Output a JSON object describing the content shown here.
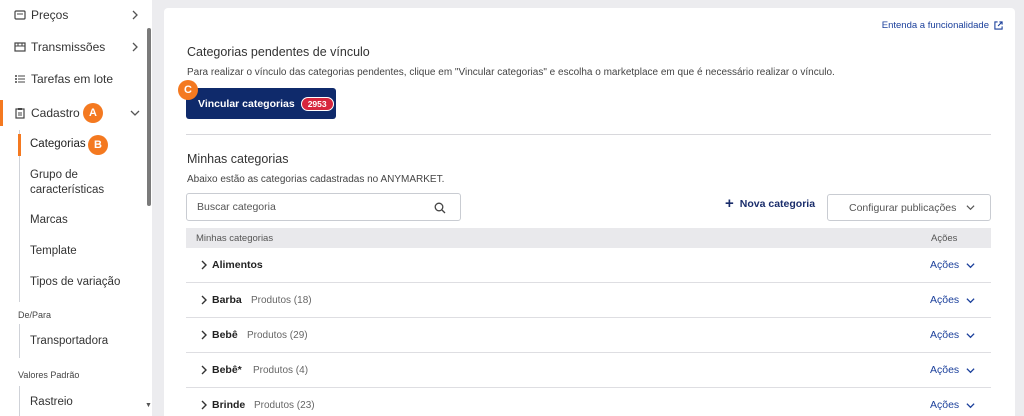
{
  "sidebar": {
    "items": [
      {
        "label": "Preços",
        "icon": "price-tag-icon"
      },
      {
        "label": "Transmissões",
        "icon": "broadcast-icon"
      },
      {
        "label": "Tarefas em lote",
        "icon": "list-icon"
      },
      {
        "label": "Cadastro",
        "icon": "clipboard-icon"
      }
    ],
    "cadastro_sub": [
      "Categorias",
      "Grupo de características",
      "Marcas",
      "Template",
      "Tipos de variação"
    ],
    "sections": [
      {
        "label": "De/Para",
        "items": [
          "Transportadora"
        ]
      },
      {
        "label": "Valores Padrão",
        "items": [
          "Rastreio"
        ]
      }
    ],
    "badge_a": "A",
    "badge_b": "B"
  },
  "main": {
    "help_link": "Entenda a funcionalidade",
    "pending_title": "Categorias pendentes de vínculo",
    "pending_desc": "Para realizar o vínculo das categorias pendentes, clique em \"Vincular categorias\" e escolha o marketplace em que é necessário realizar o vínculo.",
    "vincular_label": "Vincular categorias",
    "pending_count": "2953",
    "badge_c": "C",
    "mine_title": "Minhas categorias",
    "mine_desc": "Abaixo estão as categorias cadastradas no ANYMARKET.",
    "search_placeholder": "Buscar categoria",
    "nova_label": "Nova categoria",
    "config_label": "Configurar publicações",
    "table": {
      "col_name": "Minhas categorias",
      "col_actions": "Ações",
      "rows": [
        {
          "name": "Alimentos",
          "count": ""
        },
        {
          "name": "Barba",
          "count": "Produtos (18)"
        },
        {
          "name": "Bebê",
          "count": "Produtos (29)"
        },
        {
          "name": "Bebê*",
          "count": "Produtos (4)"
        },
        {
          "name": "Brinde",
          "count": "Produtos (23)"
        }
      ],
      "actions_label": "Ações"
    }
  },
  "colors": {
    "accent": "#f47920",
    "primary": "#0f2a6b",
    "count_pill": "#d7263d",
    "link": "#1a3f9b"
  }
}
